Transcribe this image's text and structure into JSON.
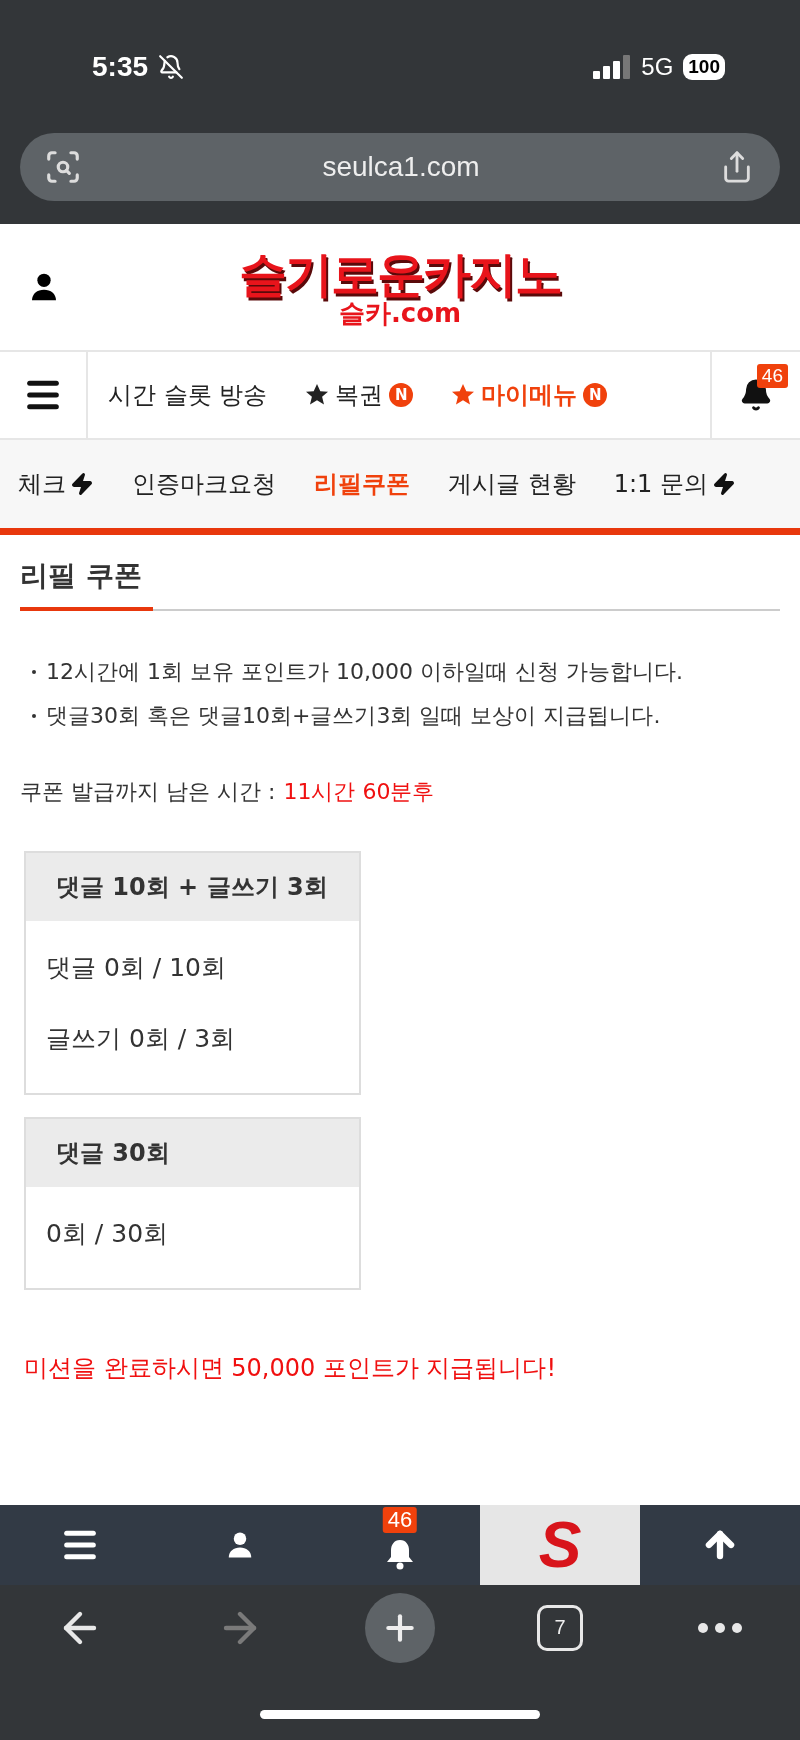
{
  "status_bar": {
    "time": "5:35",
    "network": "5G",
    "battery": "100"
  },
  "address_bar": {
    "url": "seulca1.com"
  },
  "header": {
    "logo_title": "슬기로운카지노",
    "logo_subtitle": "슬카.com"
  },
  "main_nav": {
    "items": [
      {
        "kind": "plain",
        "label": "시간 슬롯 방송",
        "highlighted": false
      },
      {
        "kind": "star",
        "label": "복권",
        "badge": "N",
        "highlighted": false
      },
      {
        "kind": "star",
        "label": "마이메뉴",
        "badge": "N",
        "highlighted": true
      }
    ],
    "notifications": "46"
  },
  "sub_nav": {
    "items": [
      {
        "label": "체크",
        "bolt": true,
        "selected": false
      },
      {
        "label": "인증마크요청",
        "bolt": false,
        "selected": false
      },
      {
        "label": "리필쿠폰",
        "bolt": false,
        "selected": true
      },
      {
        "label": "게시글 현황",
        "bolt": false,
        "selected": false
      },
      {
        "label": "1:1 문의",
        "bolt": true,
        "selected": false
      }
    ]
  },
  "page": {
    "title": "리필 쿠폰",
    "notes": [
      "12시간에 1회 보유 포인트가 10,000 이하일때 신청 가능합니다.",
      "댓글30회 혹은 댓글10회+글쓰기3회 일때 보상이 지급됩니다."
    ],
    "countdown": {
      "label": "쿠폰 발급까지 남은 시간 :",
      "value": "11시간 60분후"
    },
    "missions": [
      {
        "title": "댓글 10회 + 글쓰기 3회",
        "lines": [
          "댓글 0회 / 10회",
          "글쓰기 0회 / 3회"
        ]
      },
      {
        "title": "댓글 30회",
        "lines": [
          "0회 / 30회"
        ]
      }
    ],
    "reward": "미션을 완료하시면 50,000 포인트가 지급됩니다!"
  },
  "site_bar": {
    "items": [
      {
        "kind": "menu"
      },
      {
        "kind": "user"
      },
      {
        "kind": "bell",
        "badge": "46"
      },
      {
        "kind": "logo",
        "label": "S"
      },
      {
        "kind": "top"
      }
    ]
  },
  "browser_toolbar": {
    "buttons": [
      {
        "kind": "back",
        "disabled": false
      },
      {
        "kind": "forward",
        "disabled": true
      },
      {
        "kind": "new_tab",
        "disabled": false
      },
      {
        "kind": "tabs",
        "label": "7",
        "disabled": false
      },
      {
        "kind": "more",
        "disabled": false
      }
    ]
  }
}
